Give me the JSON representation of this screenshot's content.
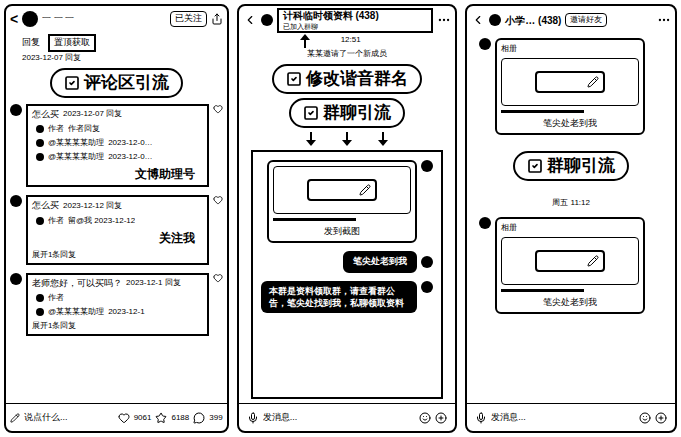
{
  "comment_screen": {
    "header": {
      "back": "<",
      "name": "一 一 一",
      "follow": "已关注"
    },
    "pinned": {
      "label": "回复",
      "tag": "置顶获取",
      "meta": "2023-12-07 回复"
    },
    "annotation": "评论区引流",
    "comments": [
      {
        "text": "怎么买",
        "meta": "2023-12-07 回复",
        "note": "文博助理号",
        "replies": [
          {
            "author": "作者",
            "text": "作者回复"
          },
          {
            "author": "@某某某某助理",
            "text": "2023-12-0…"
          },
          {
            "author": "@某某某某助理",
            "text": "2023-12-0…"
          }
        ],
        "expand": ""
      },
      {
        "text": "怎么买",
        "meta": "2023-12-12 回复",
        "note": "关注我",
        "replies": [
          {
            "author": "作者",
            "text": "留@我 2023-12-12"
          }
        ],
        "expand": "展开1条回复"
      },
      {
        "text": "老师您好，可以买吗？",
        "meta": "2023-12-1 回复",
        "note": "",
        "replies": [
          {
            "author": "作者",
            "text": ""
          },
          {
            "author": "@某某某某助理",
            "text": "2023-12-1"
          }
        ],
        "expand": "展开1条回复"
      }
    ],
    "footer": {
      "placeholder": "说点什么...",
      "likes": "9061",
      "stars": "6188",
      "comments": "399"
    }
  },
  "group_chat_1": {
    "title": "计科临时领资料 (438)",
    "subtitle": "已加入群聊",
    "time": "12:51",
    "system": "某某邀请了一个新成员",
    "annotations": [
      "修改谐音群名",
      "群聊引流"
    ],
    "image_caption": "发到截图",
    "sticker": "笔尖处老到我",
    "long_text": "本群是资料领取群，请查看群公告，笔尖处找到我，私聊领取资料",
    "input": "发消息..."
  },
  "group_chat_2": {
    "title": "小学… (438)",
    "action": "邀请好友",
    "time": "周五 11:12",
    "annotation": "群聊引流",
    "cards": [
      {
        "label": "相册",
        "caption": "笔尖处老到我"
      },
      {
        "label": "相册",
        "caption": "笔尖处老到我"
      }
    ],
    "input": "发消息..."
  }
}
